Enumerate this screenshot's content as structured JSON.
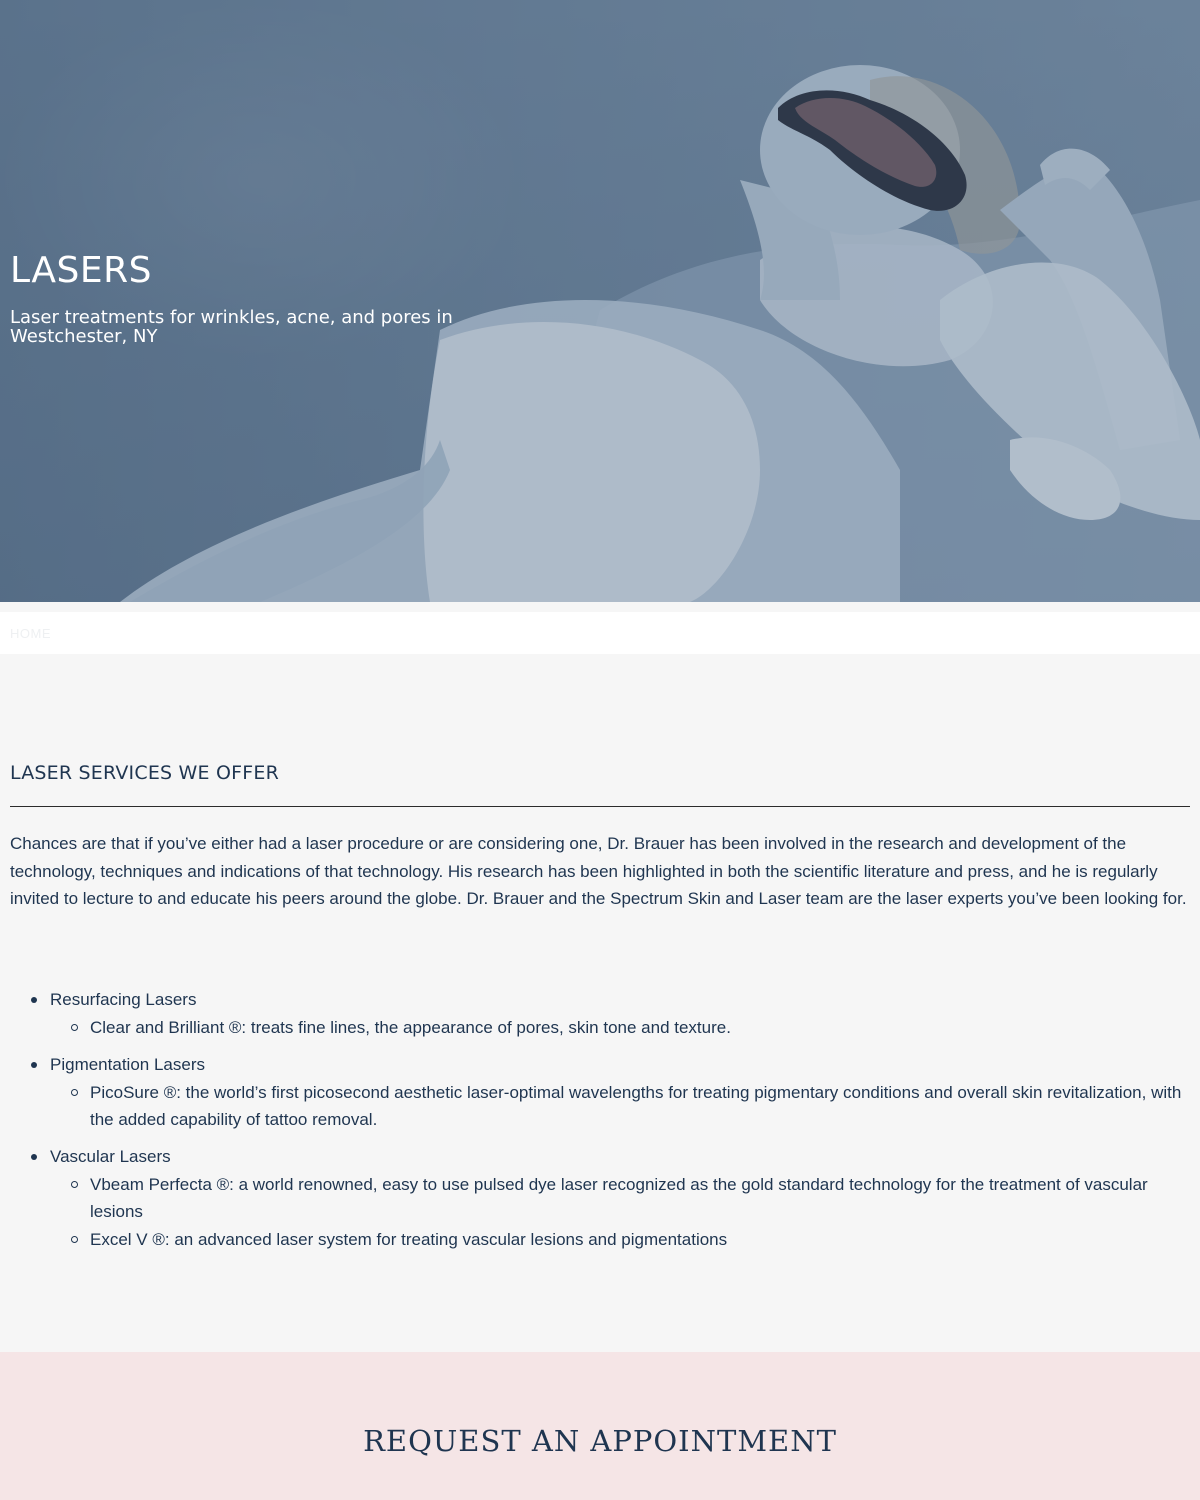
{
  "hero": {
    "title": "LASERS",
    "subtitle": "Laser treatments for wrinkles, acne, and pores in Westchester, NY"
  },
  "breadcrumb": {
    "home": "HOME"
  },
  "main": {
    "section_title": "LASER SERVICES WE OFFER",
    "intro": "Chances are that if you’ve either had a laser procedure or are considering one, Dr. Brauer has been involved in the research and development of the technology, techniques and indications of that technology. His research has been highlighted in both the scientific literature and press, and he is regularly invited to lecture to and educate his peers around the globe. Dr. Brauer and the Spectrum Skin and Laser team are the laser experts you’ve been looking for.",
    "services": [
      {
        "category": "Resurfacing Lasers",
        "items": [
          "Clear and Brilliant ®: treats fine lines, the appearance of pores, skin tone and texture."
        ]
      },
      {
        "category": "Pigmentation Lasers",
        "items": [
          "PicoSure ®: the world’s first picosecond aesthetic laser-optimal wavelengths for treating pigmentary conditions and overall skin revitalization, with the added capability of tattoo removal."
        ]
      },
      {
        "category": "Vascular Lasers",
        "items": [
          "Vbeam Perfecta ®: a world renowned, easy to use pulsed dye laser recognized as the gold standard technology for the treatment of vascular lesions",
          "Excel V ®: an advanced laser system for treating vascular lesions and pigmentations"
        ]
      }
    ]
  },
  "cta": {
    "title": "REQUEST AN APPOINTMENT"
  },
  "colors": {
    "navy": "#1f3550",
    "hero_overlay": "#6b8196",
    "cta_background": "#f5e5e6",
    "page_background": "#f6f6f6"
  }
}
